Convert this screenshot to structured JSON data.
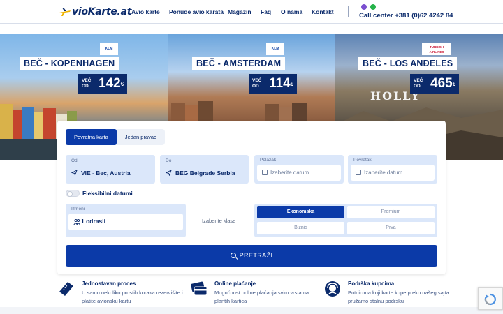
{
  "header": {
    "logo_text": "vioKarte.at",
    "nav": [
      {
        "label": "Avio karte"
      },
      {
        "label": "Ponude avio karata"
      },
      {
        "label": "Magazin"
      },
      {
        "label": "Faq"
      },
      {
        "label": "O nama"
      },
      {
        "label": "Kontakt"
      }
    ],
    "call_center": "Call center +381 (0)62 4242 84"
  },
  "hero": [
    {
      "title": "BEČ - KOPENHAGEN",
      "price_from": "VEĆ OD",
      "price": "142",
      "currency": "€",
      "airline": "KLM"
    },
    {
      "title": "BEČ - AMSTERDAM",
      "price_from": "VEĆ OD",
      "price": "114",
      "currency": "€",
      "airline": "KLM"
    },
    {
      "title": "BEČ - LOS ANĐELES",
      "price_from": "VEĆ OD",
      "price": "465",
      "currency": "€",
      "airline": "TURKISH AIRLINES",
      "sign": "HOLLY"
    }
  ],
  "search": {
    "tabs": [
      "Povratna karta",
      "Jedan pravac"
    ],
    "from_label": "Od",
    "from_value": "VIE - Bec, Austria",
    "to_label": "Do",
    "to_value": "BEG Belgrade Serbia",
    "depart_label": "Polazak",
    "depart_placeholder": "Izaberite datum",
    "return_label": "Povratak",
    "return_placeholder": "Izaberite datum",
    "flexible_label": "Fleksibilni datumi",
    "passengers_label": "Izmeni",
    "passengers_value": "1 odrasli",
    "class_label": "Izaberite klase",
    "classes": [
      "Ekonomska",
      "Premium",
      "Biznis",
      "Prva"
    ],
    "submit": "PRETRAŽI"
  },
  "features": [
    {
      "title": "Jednostavan proces",
      "desc": "U samo nekoliko prostih koraka rezervišite i platite avionsku kartu"
    },
    {
      "title": "Online plaćanje",
      "desc": "Mogućnost online plaćanja svim vrstama plantih kartica"
    },
    {
      "title": "Podrška kupcima",
      "desc": "Putnicima koji karte kupe preko našeg sajta pružamo stalnu podrsku"
    }
  ],
  "colors": {
    "primary": "#0b3aa8",
    "navy": "#0b2a6b",
    "field_bg": "#dbe7fa"
  }
}
